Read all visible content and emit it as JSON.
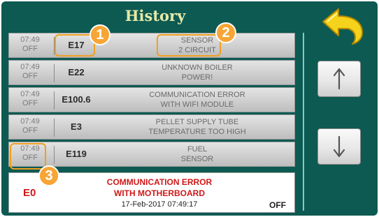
{
  "header": {
    "title": "History"
  },
  "entries": [
    {
      "time": "07:49",
      "status": "OFF",
      "code": "E17",
      "desc_line1": "SENSOR",
      "desc_line2": "2 CIRCUIT"
    },
    {
      "time": "07:49",
      "status": "OFF",
      "code": "E22",
      "desc_line1": "UNKNOWN BOILER",
      "desc_line2": "POWER!"
    },
    {
      "time": "07:49",
      "status": "OFF",
      "code": "E100.6",
      "desc_line1": "COMMUNICATION ERROR",
      "desc_line2": "WITH WIFI MODULE"
    },
    {
      "time": "07:49",
      "status": "OFF",
      "code": "E3",
      "desc_line1": "PELLET SUPPLY TUBE",
      "desc_line2": "TEMPERATURE TOO HIGH"
    },
    {
      "time": "07:49",
      "status": "OFF",
      "code": "E119",
      "desc_line1": "FUEL",
      "desc_line2": "SENSOR"
    }
  ],
  "current": {
    "code": "E0",
    "desc_line1": "COMMUNICATION ERROR",
    "desc_line2": "WITH MOTHERBOARD",
    "timestamp": "17-Feb-2017 07:49:17",
    "status": "OFF"
  },
  "nav": {
    "back_icon": "back-arrow-icon",
    "up_icon": "arrow-up-icon",
    "down_icon": "arrow-down-icon"
  },
  "annotations": [
    "1",
    "2",
    "3"
  ],
  "colors": {
    "background": "#0d5a52",
    "title": "#e6e9a8",
    "error": "#d01818",
    "marker": "#f7a535",
    "back_arrow": "#f5d21b"
  }
}
